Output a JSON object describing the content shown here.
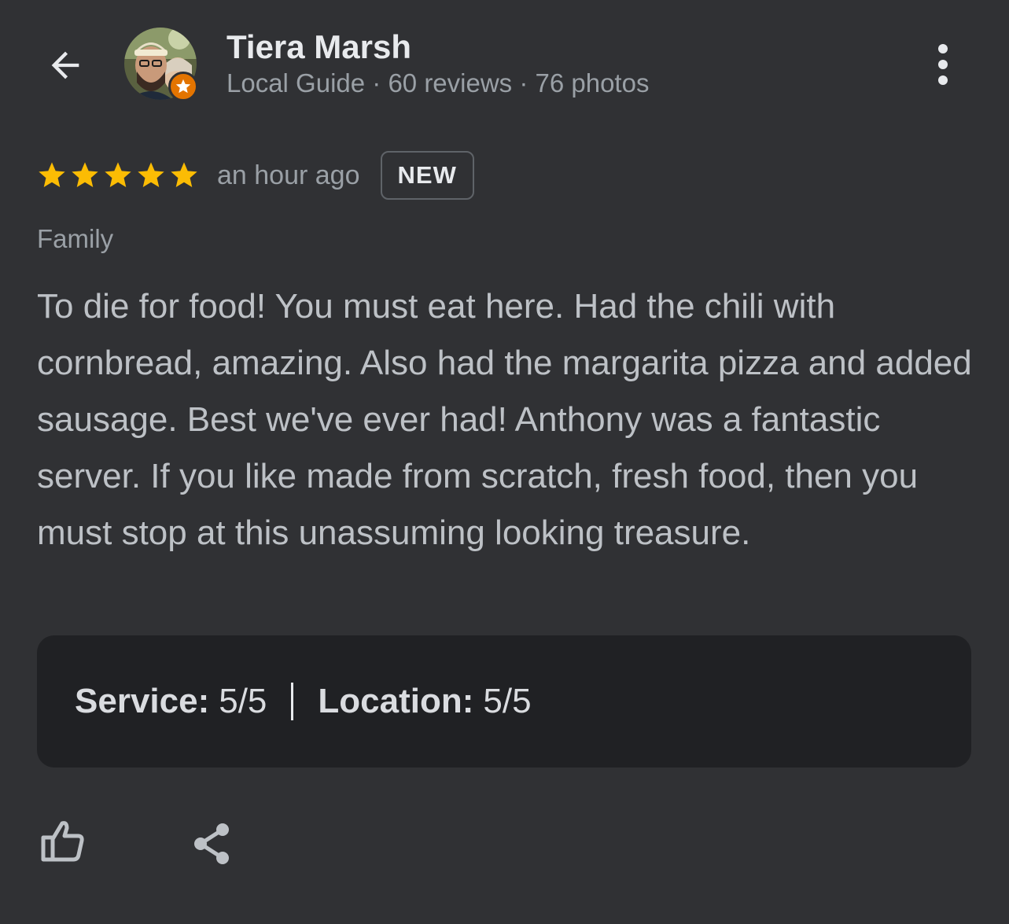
{
  "reviewer": {
    "name": "Tiera Marsh",
    "meta": "Local Guide · 60 reviews · 76 photos"
  },
  "review": {
    "rating": 5,
    "rating_max": 5,
    "time_ago": "an hour ago",
    "badge": "NEW",
    "trip_type": "Family",
    "text": "To die for food! You must eat here. Had the chili with cornbread, amazing. Also had the margarita pizza and added sausage. Best we've ever had! Anthony was a fantastic server. If you like made from scratch, fresh food, then you must stop at this unassuming looking treasure."
  },
  "attributes": [
    {
      "label": "Service:",
      "value": "5/5"
    },
    {
      "label": "Location:",
      "value": "5/5"
    }
  ],
  "icons": {
    "back": "arrow-back-icon",
    "more": "more-vertical-icon",
    "star": "star-icon",
    "badge": "local-guide-star-icon",
    "like": "thumb-up-icon",
    "share": "share-icon"
  },
  "colors": {
    "background": "#303134",
    "star": "#fbbc04",
    "local_guide_badge": "#e37400",
    "attributes_box": "#202124"
  }
}
